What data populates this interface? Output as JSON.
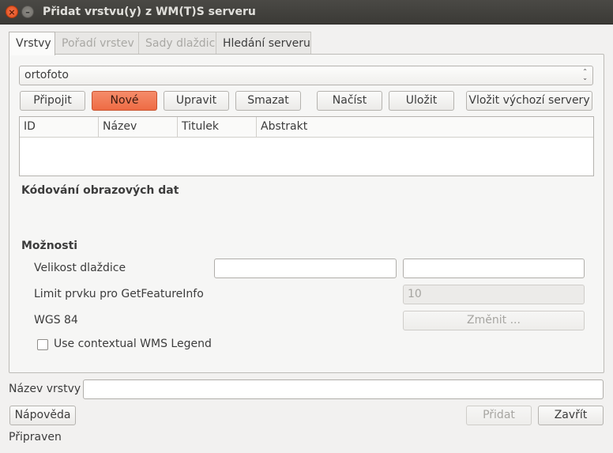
{
  "window": {
    "title": "Přidat vrstvu(y) z WM(T)S serveru",
    "close_glyph": "×",
    "minimize_glyph": "–"
  },
  "tabs": [
    {
      "label": "Vrstvy",
      "state": "active"
    },
    {
      "label": "Pořadí vrstev",
      "state": "disabled"
    },
    {
      "label": "Sady dlaždic",
      "state": "disabled"
    },
    {
      "label": "Hledání serveru",
      "state": "normal"
    }
  ],
  "connection": {
    "selected": "ortofoto",
    "arrows": "⌃⌄"
  },
  "buttons": {
    "connect": "Připojit",
    "new": "Nové",
    "edit": "Upravit",
    "delete": "Smazat",
    "load": "Načíst",
    "save": "Uložit",
    "add_default": "Vložit výchozí servery"
  },
  "layers_table": {
    "columns": [
      "ID",
      "Název",
      "Titulek",
      "Abstrakt"
    ],
    "rows": []
  },
  "image_encoding": {
    "heading": "Kódování obrazových dat"
  },
  "options": {
    "heading": "Možnosti",
    "tile_size_label": "Velikost dlaždice",
    "tile_width": "",
    "tile_height": "",
    "feature_limit_label": "Limit prvku pro GetFeatureInfo",
    "feature_limit_value": "10",
    "crs_label": "WGS 84",
    "change_button": "Změnit ...",
    "contextual_legend_label": "Use contextual WMS Legend",
    "contextual_legend_checked": false
  },
  "layer_name": {
    "label": "Název vrstvy",
    "value": ""
  },
  "footer": {
    "help": "Nápověda",
    "add": "Přidat",
    "close": "Zavřít",
    "status": "Připraven"
  }
}
